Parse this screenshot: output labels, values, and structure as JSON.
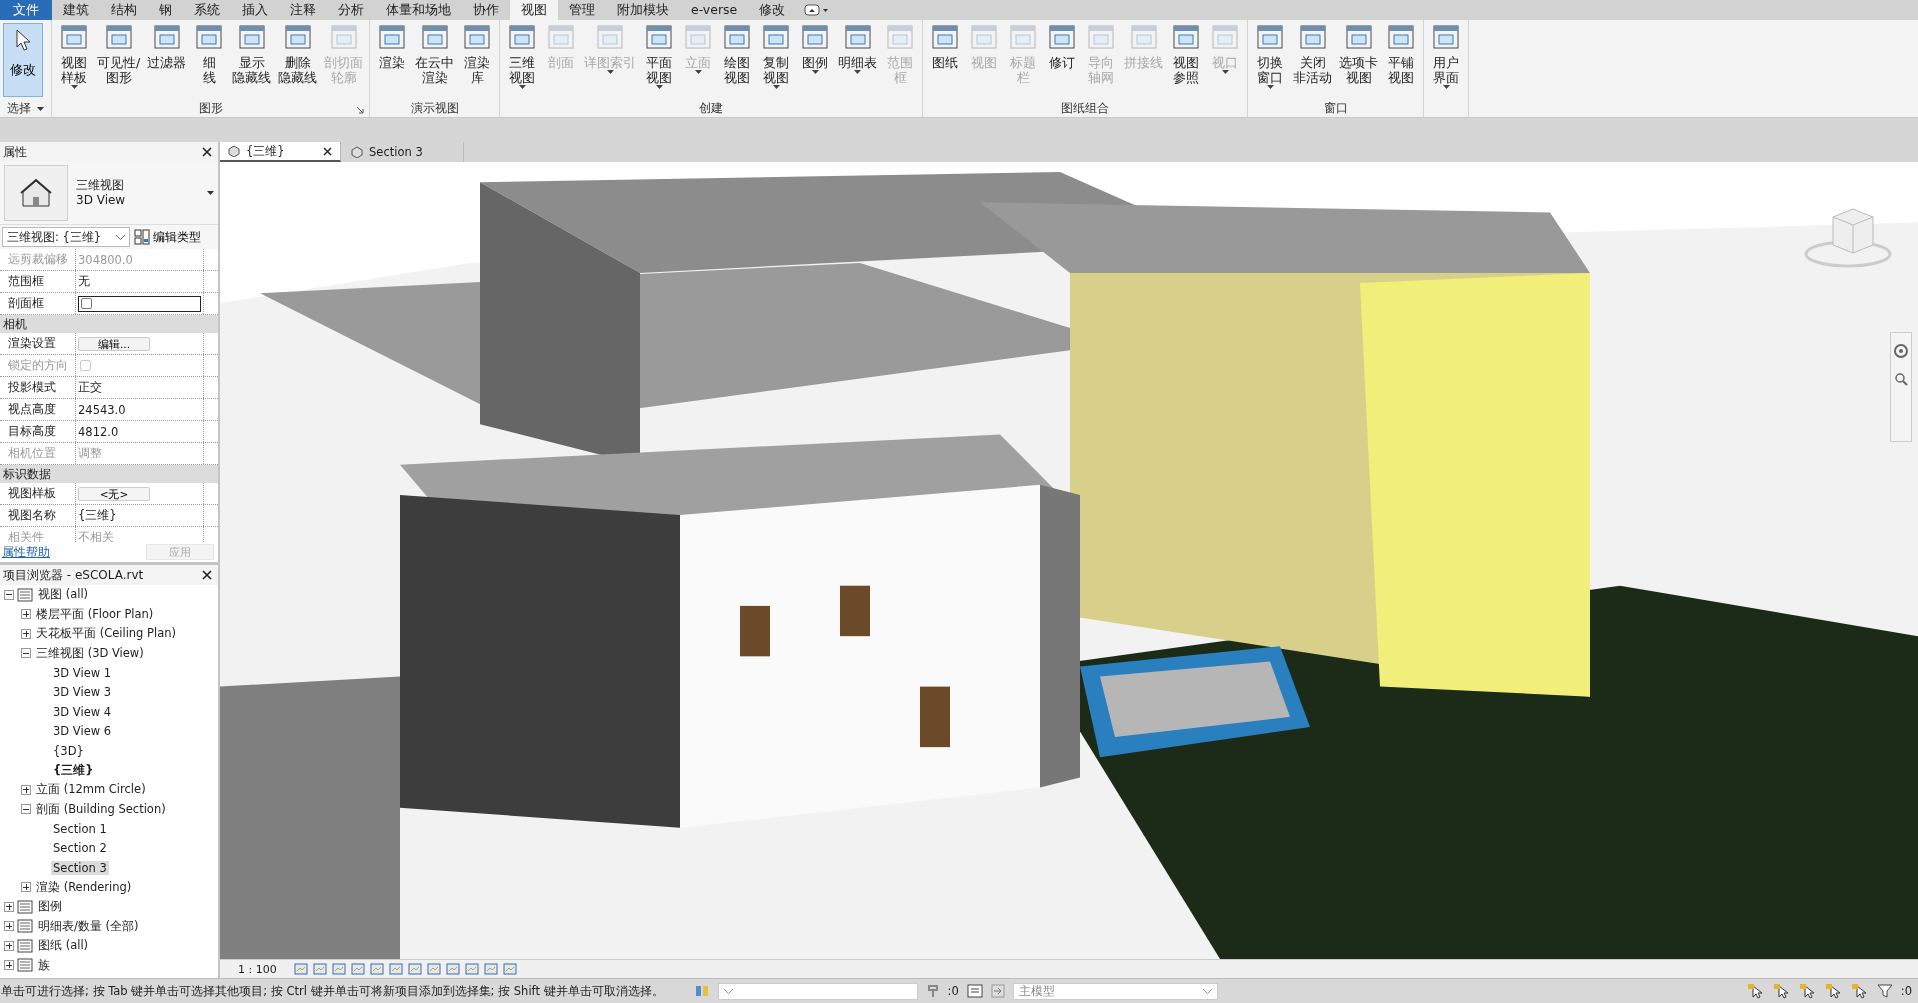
{
  "ribbon_tabs": [
    {
      "label": "文件",
      "kind": "file",
      "selected": false
    },
    {
      "label": "建筑",
      "kind": "tab",
      "selected": false
    },
    {
      "label": "结构",
      "kind": "tab",
      "selected": false
    },
    {
      "label": "钢",
      "kind": "tab",
      "selected": false
    },
    {
      "label": "系统",
      "kind": "tab",
      "selected": false
    },
    {
      "label": "插入",
      "kind": "tab",
      "selected": false
    },
    {
      "label": "注释",
      "kind": "tab",
      "selected": false
    },
    {
      "label": "分析",
      "kind": "tab",
      "selected": false
    },
    {
      "label": "体量和场地",
      "kind": "tab",
      "selected": false
    },
    {
      "label": "协作",
      "kind": "tab",
      "selected": false
    },
    {
      "label": "视图",
      "kind": "tab",
      "selected": true
    },
    {
      "label": "管理",
      "kind": "tab",
      "selected": false
    },
    {
      "label": "附加模块",
      "kind": "tab",
      "selected": false
    },
    {
      "label": "e-verse",
      "kind": "tab",
      "selected": false
    },
    {
      "label": "修改",
      "kind": "tab",
      "selected": false
    }
  ],
  "ribbon": {
    "modify_tool": {
      "label": "修改",
      "selected": true
    },
    "select_menu": "选择",
    "groups": [
      {
        "title": "图形",
        "launcher": true,
        "tools": [
          {
            "lines": [
              "视图",
              "样板"
            ],
            "dropdown": true,
            "disabled": false
          },
          {
            "lines": [
              "可见性/",
              "图形"
            ],
            "dropdown": false,
            "disabled": false
          },
          {
            "lines": [
              "过滤器"
            ],
            "dropdown": false,
            "disabled": false
          },
          {
            "lines": [
              "细",
              "线"
            ],
            "dropdown": false,
            "disabled": false
          },
          {
            "lines": [
              "显示",
              "隐藏线"
            ],
            "dropdown": false,
            "disabled": false
          },
          {
            "lines": [
              "删除",
              "隐藏线"
            ],
            "dropdown": false,
            "disabled": false
          },
          {
            "lines": [
              "剖切面",
              "轮廓"
            ],
            "dropdown": false,
            "disabled": true
          }
        ]
      },
      {
        "title": "演示视图",
        "tools": [
          {
            "lines": [
              "渲染"
            ],
            "dropdown": false,
            "disabled": false
          },
          {
            "lines": [
              "在云中",
              "渲染"
            ],
            "dropdown": false,
            "disabled": false
          },
          {
            "lines": [
              "渲染",
              "库"
            ],
            "dropdown": false,
            "disabled": false
          }
        ]
      },
      {
        "title": "创建",
        "tools": [
          {
            "lines": [
              "三维",
              "视图"
            ],
            "dropdown": true,
            "disabled": false
          },
          {
            "lines": [
              "剖面"
            ],
            "dropdown": false,
            "disabled": true
          },
          {
            "lines": [
              "详图索引"
            ],
            "dropdown": true,
            "disabled": true
          },
          {
            "lines": [
              "平面",
              "视图"
            ],
            "dropdown": true,
            "disabled": false
          },
          {
            "lines": [
              "立面"
            ],
            "dropdown": true,
            "disabled": true
          },
          {
            "lines": [
              "绘图",
              "视图"
            ],
            "dropdown": false,
            "disabled": false
          },
          {
            "lines": [
              "复制",
              "视图"
            ],
            "dropdown": true,
            "disabled": false
          },
          {
            "lines": [
              "图例"
            ],
            "dropdown": true,
            "disabled": false
          },
          {
            "lines": [
              "明细表"
            ],
            "dropdown": true,
            "disabled": false
          },
          {
            "lines": [
              "范围",
              "框"
            ],
            "dropdown": false,
            "disabled": true
          }
        ]
      },
      {
        "title": "图纸组合",
        "tools": [
          {
            "lines": [
              "图纸"
            ],
            "dropdown": false,
            "disabled": false
          },
          {
            "lines": [
              "视图"
            ],
            "dropdown": false,
            "disabled": true
          },
          {
            "lines": [
              "标题",
              "栏"
            ],
            "dropdown": false,
            "disabled": true
          },
          {
            "lines": [
              "修订"
            ],
            "dropdown": false,
            "disabled": false
          },
          {
            "lines": [
              "导向",
              "轴网"
            ],
            "dropdown": false,
            "disabled": true
          },
          {
            "lines": [
              "拼接线"
            ],
            "dropdown": false,
            "disabled": true
          },
          {
            "lines": [
              "视图",
              "参照"
            ],
            "dropdown": false,
            "disabled": false
          },
          {
            "lines": [
              "视口"
            ],
            "dropdown": true,
            "disabled": true
          }
        ]
      },
      {
        "title": "窗口",
        "tools": [
          {
            "lines": [
              "切换",
              "窗口"
            ],
            "dropdown": true,
            "disabled": false
          },
          {
            "lines": [
              "关闭",
              "非活动"
            ],
            "dropdown": false,
            "disabled": false
          },
          {
            "lines": [
              "选项卡",
              "视图"
            ],
            "dropdown": false,
            "disabled": false
          },
          {
            "lines": [
              "平铺",
              "视图"
            ],
            "dropdown": false,
            "disabled": false
          }
        ]
      },
      {
        "tools": [
          {
            "lines": [
              "用户",
              "界面"
            ],
            "dropdown": true,
            "disabled": false
          }
        ]
      }
    ]
  },
  "properties": {
    "title": "属性",
    "type_name": "三维视图",
    "type_name_en": "3D View",
    "selector": "三维视图: {三维}",
    "edit_type": "编辑类型",
    "rows": [
      {
        "kind": "text",
        "label": "远剪裁偏移",
        "value": "304800.0",
        "disabled": true
      },
      {
        "kind": "text",
        "label": "范围框",
        "value": "无",
        "disabled": false
      },
      {
        "kind": "checkbox",
        "label": "剖面框",
        "checked": false,
        "disabled": false
      },
      {
        "kind": "section",
        "label": "相机"
      },
      {
        "kind": "button",
        "label": "渲染设置",
        "value": "编辑...",
        "disabled": false
      },
      {
        "kind": "checkbox",
        "label": "锁定的方向",
        "checked": false,
        "disabled": true
      },
      {
        "kind": "text",
        "label": "投影模式",
        "value": "正交",
        "disabled": false
      },
      {
        "kind": "text",
        "label": "视点高度",
        "value": "24543.0",
        "disabled": false
      },
      {
        "kind": "text",
        "label": "目标高度",
        "value": "4812.0",
        "disabled": false
      },
      {
        "kind": "text",
        "label": "相机位置",
        "value": "调整",
        "disabled": true
      },
      {
        "kind": "section",
        "label": "标识数据"
      },
      {
        "kind": "button",
        "label": "视图样板",
        "value": "<无>",
        "disabled": false
      },
      {
        "kind": "text",
        "label": "视图名称",
        "value": "{三维}",
        "disabled": false
      },
      {
        "kind": "text",
        "label": "相关件",
        "value": "不相关",
        "disabled": true
      }
    ],
    "help_link": "属性帮助",
    "apply": "应用"
  },
  "project_browser": {
    "title": "项目浏览器 - eSCOLA.rvt",
    "tree": [
      {
        "label": "视图 (all)",
        "expanded": true,
        "selected": false,
        "children": [
          {
            "label": "楼层平面 (Floor Plan)",
            "expanded": false,
            "selected": false
          },
          {
            "label": "天花板平面 (Ceiling Plan)",
            "expanded": false,
            "selected": false
          },
          {
            "label": "三维视图 (3D View)",
            "expanded": true,
            "selected": false,
            "children": [
              {
                "label": "3D View 1",
                "selected": false
              },
              {
                "label": "3D View 3",
                "selected": false
              },
              {
                "label": "3D View 4",
                "selected": false
              },
              {
                "label": "3D View 6",
                "selected": false
              },
              {
                "label": "{3D}",
                "selected": false
              },
              {
                "label": "{三维}",
                "selected": false,
                "bold": true
              }
            ]
          },
          {
            "label": "立面 (12mm Circle)",
            "expanded": false,
            "selected": false
          },
          {
            "label": "剖面 (Building Section)",
            "expanded": true,
            "selected": false,
            "children": [
              {
                "label": "Section 1",
                "selected": false
              },
              {
                "label": "Section 2",
                "selected": false
              },
              {
                "label": "Section 3",
                "selected": true
              }
            ]
          },
          {
            "label": "渲染 (Rendering)",
            "expanded": false,
            "selected": false
          }
        ]
      },
      {
        "label": "图例",
        "expanded": false,
        "selected": false
      },
      {
        "label": "明细表/数量 (全部)",
        "expanded": false,
        "selected": false
      },
      {
        "label": "图纸 (all)",
        "expanded": false,
        "selected": false
      },
      {
        "label": "族",
        "expanded": false,
        "selected": false
      }
    ]
  },
  "view_tabs": [
    {
      "label": "{三维}",
      "selected": true,
      "closable": true
    },
    {
      "label": "Section 3",
      "selected": false,
      "closable": false
    }
  ],
  "view_control": {
    "scale": "1 : 100"
  },
  "status_bar": {
    "message": "单击可进行选择; 按 Tab 键并单击可选择其他项目; 按 Ctrl 键并单击可将新项目添加到选择集; 按 Shift 键并单击可取消选择。",
    "editing_count": ":0",
    "model_field": "主模型",
    "filter_count": ":0"
  }
}
